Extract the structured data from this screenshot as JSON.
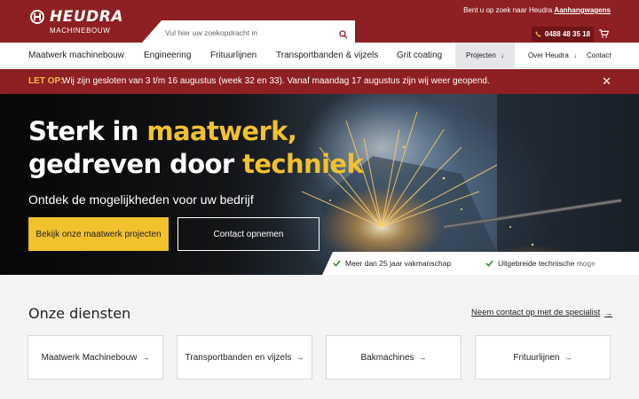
{
  "brand": {
    "name": "HEUDRA",
    "sub": "MACHINEBOUW"
  },
  "header": {
    "tagline_prefix": "Bent u op zoek naar Heudra",
    "tagline_link": "Aanhangwagens",
    "search_placeholder": "Vul hier uw zoekopdracht in",
    "phone": "0488 48 35 18"
  },
  "nav": {
    "items": [
      {
        "label": "Maatwerk machinebouw"
      },
      {
        "label": "Engineering"
      },
      {
        "label": "Frituurlijnen"
      },
      {
        "label": "Transportbanden & vijzels"
      },
      {
        "label": "Grit coating"
      }
    ],
    "projecten": "Projecten",
    "over": "Over Heudra",
    "contact": "Contact"
  },
  "notice": {
    "label": "LET OP:",
    "text": "Wij zijn gesloten van 3 t/m 16 augustus (week 32 en 33). Vanaf maandag 17 augustus zijn wij weer geopend."
  },
  "hero": {
    "line1_a": "Sterk in ",
    "line1_b": "maatwerk,",
    "line2_a": "gedreven door ",
    "line2_b": "techniek",
    "subtitle": "Ontdek de mogelijkheden voor uw bedrijf",
    "primary_button": "Bekijk onze maatwerk projecten",
    "secondary_button": "Contact opnemen",
    "usps": [
      "Meer dan 25 jaar vakmanschap",
      "Uitgebreide technische moge"
    ]
  },
  "services": {
    "title": "Onze diensten",
    "link": "Neem contact op met de specialist",
    "cards": [
      "Maatwerk Machinebouw",
      "Transportbanden en vijzels",
      "Bakmachines",
      "Frituurlijnen"
    ]
  },
  "colors": {
    "brand_red": "#8e1f22",
    "accent_yellow": "#f2c12e",
    "check_green": "#2e8b3a"
  }
}
